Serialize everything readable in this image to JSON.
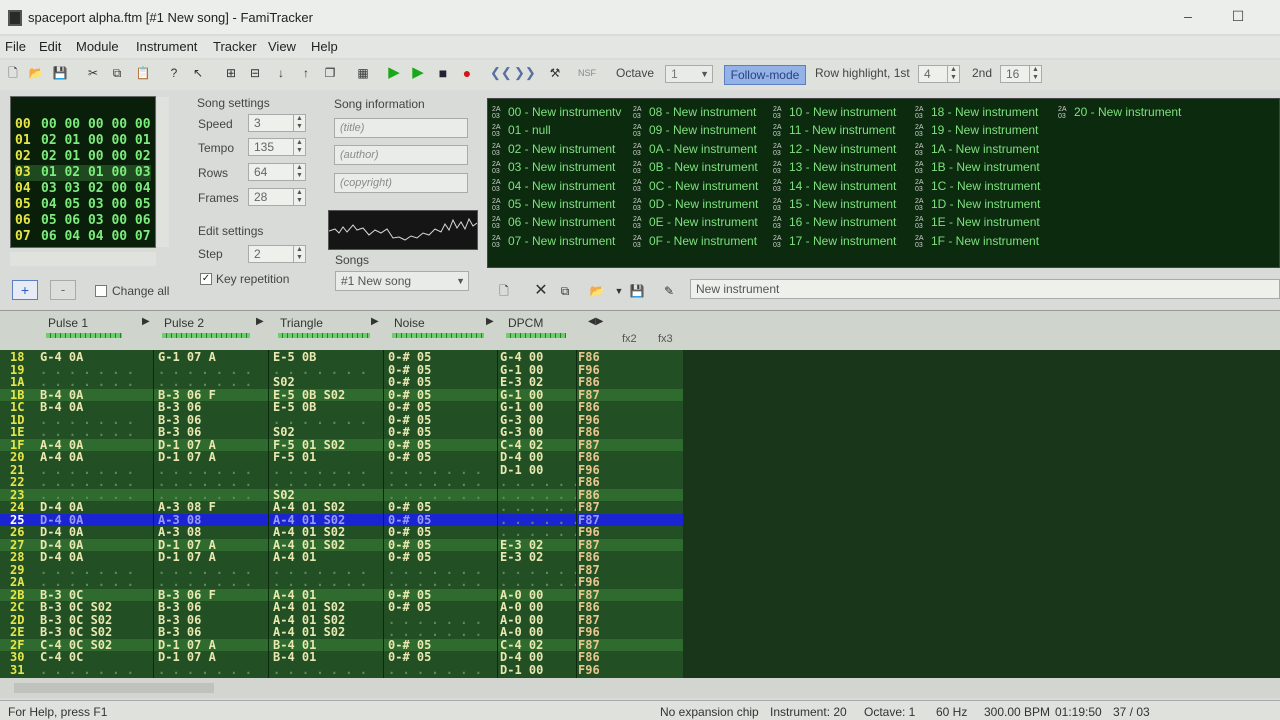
{
  "window": {
    "title": "spaceport alpha.ftm [#1 New song] - FamiTracker",
    "minimize": "–",
    "maximize": "☐"
  },
  "menu": [
    "File",
    "Edit",
    "Module",
    "Instrument",
    "Tracker",
    "View",
    "Help"
  ],
  "toolbar": {
    "octave_label": "Octave",
    "octave_value": "1",
    "follow_mode": "Follow-mode",
    "row_highlight_label": "Row highlight, 1st",
    "row_highlight_1st": "4",
    "second_label": "2nd",
    "row_highlight_2nd": "16",
    "nsf": "NSF"
  },
  "frames": {
    "rows": [
      {
        "n": "00",
        "v": "00 00 00 00 00"
      },
      {
        "n": "01",
        "v": "02 01 00 00 01"
      },
      {
        "n": "02",
        "v": "02 01 00 00 02"
      },
      {
        "n": "03",
        "v": "01 02 01 00 03"
      },
      {
        "n": "04",
        "v": "03 03 02 00 04"
      },
      {
        "n": "05",
        "v": "04 05 03 00 05"
      },
      {
        "n": "06",
        "v": "05 06 03 00 06"
      },
      {
        "n": "07",
        "v": "06 04 04 00 07"
      }
    ],
    "add": "+",
    "remove": "-",
    "change_all": "Change all"
  },
  "song_settings": {
    "title": "Song settings",
    "speed_label": "Speed",
    "speed": "3",
    "tempo_label": "Tempo",
    "tempo": "135",
    "rows_label": "Rows",
    "rows": "64",
    "frames_label": "Frames",
    "frames": "28"
  },
  "edit_settings": {
    "title": "Edit settings",
    "step_label": "Step",
    "step": "2",
    "key_repetition": "Key repetition"
  },
  "song_info": {
    "title": "Song information",
    "title_ph": "(title)",
    "author_ph": "(author)",
    "copyright_ph": "(copyright)",
    "songs_label": "Songs",
    "song_selected": "#1 New song"
  },
  "instruments": [
    "00 - New instrumentv",
    "01 - null",
    "02 - New instrument",
    "03 - New instrument",
    "04 - New instrument",
    "05 - New instrument",
    "06 - New instrument",
    "07 - New instrument",
    "08 - New instrument",
    "09 - New instrument",
    "0A - New instrument",
    "0B - New instrument",
    "0C - New instrument",
    "0D - New instrument",
    "0E - New instrument",
    "0F - New instrument",
    "10 - New instrument",
    "11 - New instrument",
    "12 - New instrument",
    "13 - New instrument",
    "14 - New instrument",
    "15 - New instrument",
    "16 - New instrument",
    "17 - New instrument",
    "18 - New instrument",
    "19 - New instrument",
    "1A - New instrument",
    "1B - New instrument",
    "1C - New instrument",
    "1D - New instrument",
    "1E - New instrument",
    "1F - New instrument",
    "20 - New instrument"
  ],
  "instrument_name": "New instrument",
  "channels": [
    "Pulse 1",
    "Pulse 2",
    "Triangle",
    "Noise",
    "DPCM"
  ],
  "fx_labels": [
    "fx2",
    "fx3"
  ],
  "pattern_rows": [
    {
      "r": "18",
      "c": [
        "G-4 0A",
        "G-1 07 A",
        "E-5 0B",
        "0-# 05",
        "G-4 00"
      ],
      "e": "F86"
    },
    {
      "r": "19",
      "c": [
        "",
        "",
        "",
        "0-# 05",
        "G-1 00"
      ],
      "e": "F96"
    },
    {
      "r": "1A",
      "c": [
        "",
        "",
        "S02",
        "0-# 05",
        "E-3 02"
      ],
      "e": "F86"
    },
    {
      "r": "1B",
      "c": [
        "B-4 0A",
        "B-3 06 F",
        "E-5 0B S02",
        "0-# 05",
        "G-1 00"
      ],
      "e": "F87"
    },
    {
      "r": "1C",
      "c": [
        "B-4 0A",
        "B-3 06",
        "E-5 0B",
        "0-# 05",
        "G-1 00"
      ],
      "e": "F86"
    },
    {
      "r": "1D",
      "c": [
        "",
        "B-3 06",
        "",
        "0-# 05",
        "G-3 00"
      ],
      "e": "F96"
    },
    {
      "r": "1E",
      "c": [
        "",
        "B-3 06",
        "S02",
        "0-# 05",
        "G-3 00"
      ],
      "e": "F86"
    },
    {
      "r": "1F",
      "c": [
        "A-4 0A",
        "D-1 07 A",
        "F-5 01 S02",
        "0-# 05",
        "C-4 02"
      ],
      "e": "F87"
    },
    {
      "r": "20",
      "c": [
        "A-4 0A",
        "D-1 07 A",
        "F-5 01",
        "0-# 05",
        "D-4 00"
      ],
      "e": "F86"
    },
    {
      "r": "21",
      "c": [
        "",
        "",
        "",
        "",
        "D-1 00"
      ],
      "e": "F96"
    },
    {
      "r": "22",
      "c": [
        "",
        "",
        "",
        "",
        ""
      ],
      "e": "F86"
    },
    {
      "r": "23",
      "c": [
        "",
        "",
        "S02",
        "",
        ""
      ],
      "e": "F86"
    },
    {
      "r": "24",
      "c": [
        "D-4 0A",
        "A-3 08 F",
        "A-4 01 S02",
        "0-# 05",
        ""
      ],
      "e": "F87"
    },
    {
      "r": "25",
      "c": [
        "D-4 0A",
        "A-3 08",
        "A-4 01 S02",
        "0-# 05",
        ""
      ],
      "e": "F87"
    },
    {
      "r": "26",
      "c": [
        "D-4 0A",
        "A-3 08",
        "A-4 01 S02",
        "0-# 05",
        ""
      ],
      "e": "F96"
    },
    {
      "r": "27",
      "c": [
        "D-4 0A",
        "D-1 07 A",
        "A-4 01 S02",
        "0-# 05",
        "E-3 02"
      ],
      "e": "F87"
    },
    {
      "r": "28",
      "c": [
        "D-4 0A",
        "D-1 07 A",
        "A-4 01",
        "0-# 05",
        "E-3 02"
      ],
      "e": "F86"
    },
    {
      "r": "29",
      "c": [
        "",
        "",
        "",
        "",
        ""
      ],
      "e": "F87"
    },
    {
      "r": "2A",
      "c": [
        "",
        "",
        "",
        "",
        ""
      ],
      "e": "F96"
    },
    {
      "r": "2B",
      "c": [
        "B-3 0C",
        "B-3 06 F",
        "A-4 01",
        "0-# 05",
        "A-0 00"
      ],
      "e": "F87"
    },
    {
      "r": "2C",
      "c": [
        "B-3 0C S02",
        "B-3 06",
        "A-4 01 S02",
        "0-# 05",
        "A-0 00"
      ],
      "e": "F86"
    },
    {
      "r": "2D",
      "c": [
        "B-3 0C S02",
        "B-3 06",
        "A-4 01 S02",
        "",
        "A-0 00"
      ],
      "e": "F87"
    },
    {
      "r": "2E",
      "c": [
        "B-3 0C S02",
        "B-3 06",
        "A-4 01 S02",
        "",
        "A-0 00"
      ],
      "e": "F96"
    },
    {
      "r": "2F",
      "c": [
        "C-4 0C S02",
        "D-1 07 A",
        "B-4 01",
        "0-# 05",
        "C-4 02"
      ],
      "e": "F87"
    },
    {
      "r": "30",
      "c": [
        "C-4 0C",
        "D-1 07 A",
        "B-4 01",
        "0-# 05",
        "D-4 00"
      ],
      "e": "F86"
    },
    {
      "r": "31",
      "c": [
        "",
        "",
        "",
        "",
        "D-1 00"
      ],
      "e": "F96"
    }
  ],
  "status": {
    "help": "For Help, press F1",
    "chip": "No expansion chip",
    "instrument": "Instrument: 20",
    "octave": "Octave: 1",
    "rate": "60 Hz",
    "bpm": "300.00 BPM",
    "time": "01:19:50",
    "pos": "37 / 03"
  }
}
